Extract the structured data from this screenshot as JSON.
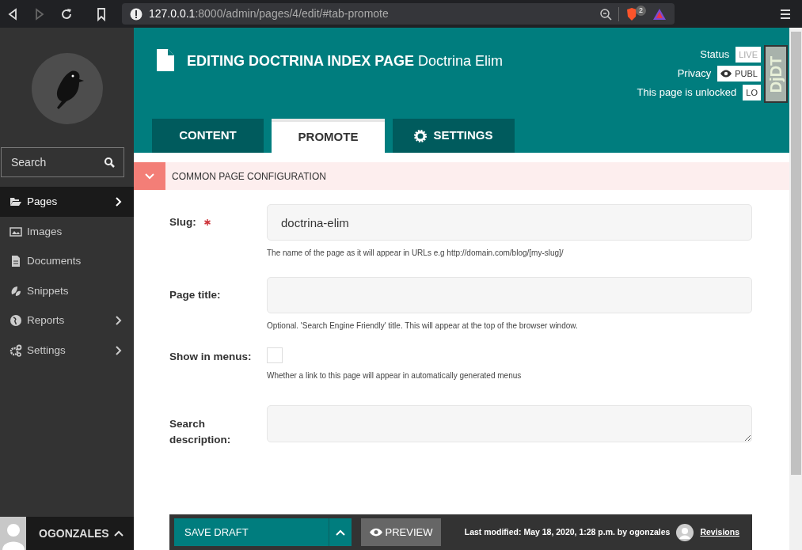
{
  "browser": {
    "url_host": "127.0.0.1",
    "url_path": ":8000/admin/pages/4/edit/#tab-promote",
    "shield_count": "2"
  },
  "sidebar": {
    "search": {
      "placeholder": "Search"
    },
    "items": [
      {
        "label": "Pages",
        "selected": true,
        "has_children": true
      },
      {
        "label": "Images",
        "selected": false,
        "has_children": false
      },
      {
        "label": "Documents",
        "selected": false,
        "has_children": false
      },
      {
        "label": "Snippets",
        "selected": false,
        "has_children": false
      },
      {
        "label": "Reports",
        "selected": false,
        "has_children": true
      },
      {
        "label": "Settings",
        "selected": false,
        "has_children": true
      }
    ],
    "user": {
      "name": "OGONZALES"
    }
  },
  "header": {
    "title": "EDITING DOCTRINA INDEX PAGE",
    "subtitle": "Doctrina Elim",
    "meta": [
      {
        "kind": "status",
        "label": "Status",
        "value": "LIVE"
      },
      {
        "kind": "privacy",
        "label": "Privacy",
        "value": "PUBL"
      },
      {
        "kind": "lock",
        "label": "This page is unlocked",
        "value": "LO"
      }
    ],
    "debug_toolbar": "DjDT"
  },
  "tabs": [
    {
      "label": "CONTENT",
      "selected": false
    },
    {
      "label": "PROMOTE",
      "selected": true
    },
    {
      "label": "SETTINGS",
      "selected": false
    }
  ],
  "section": {
    "title": "COMMON PAGE CONFIGURATION",
    "expanded": true
  },
  "fields": [
    {
      "kind": "text",
      "label": "Slug:",
      "required": true,
      "value": "doctrina-elim",
      "help": "The name of the page as it will appear in URLs e.g http://domain.com/blog/[my-slug]/"
    },
    {
      "kind": "text",
      "label": "Page title:",
      "required": false,
      "help": "Optional. 'Search Engine Friendly' title. This will appear at the top of the browser window."
    },
    {
      "kind": "checkbox",
      "label": "Show in menus:",
      "required": false,
      "checked": false,
      "help": "Whether a link to this page will appear in automatically generated menus"
    },
    {
      "kind": "textarea",
      "label": "Search description:",
      "required": false
    }
  ],
  "footer": {
    "save": "SAVE DRAFT",
    "preview": "PREVIEW",
    "last_modified": "Last modified: May 18, 2020, 1:28 p.m. by ogonzales",
    "revisions": "Revisions"
  }
}
